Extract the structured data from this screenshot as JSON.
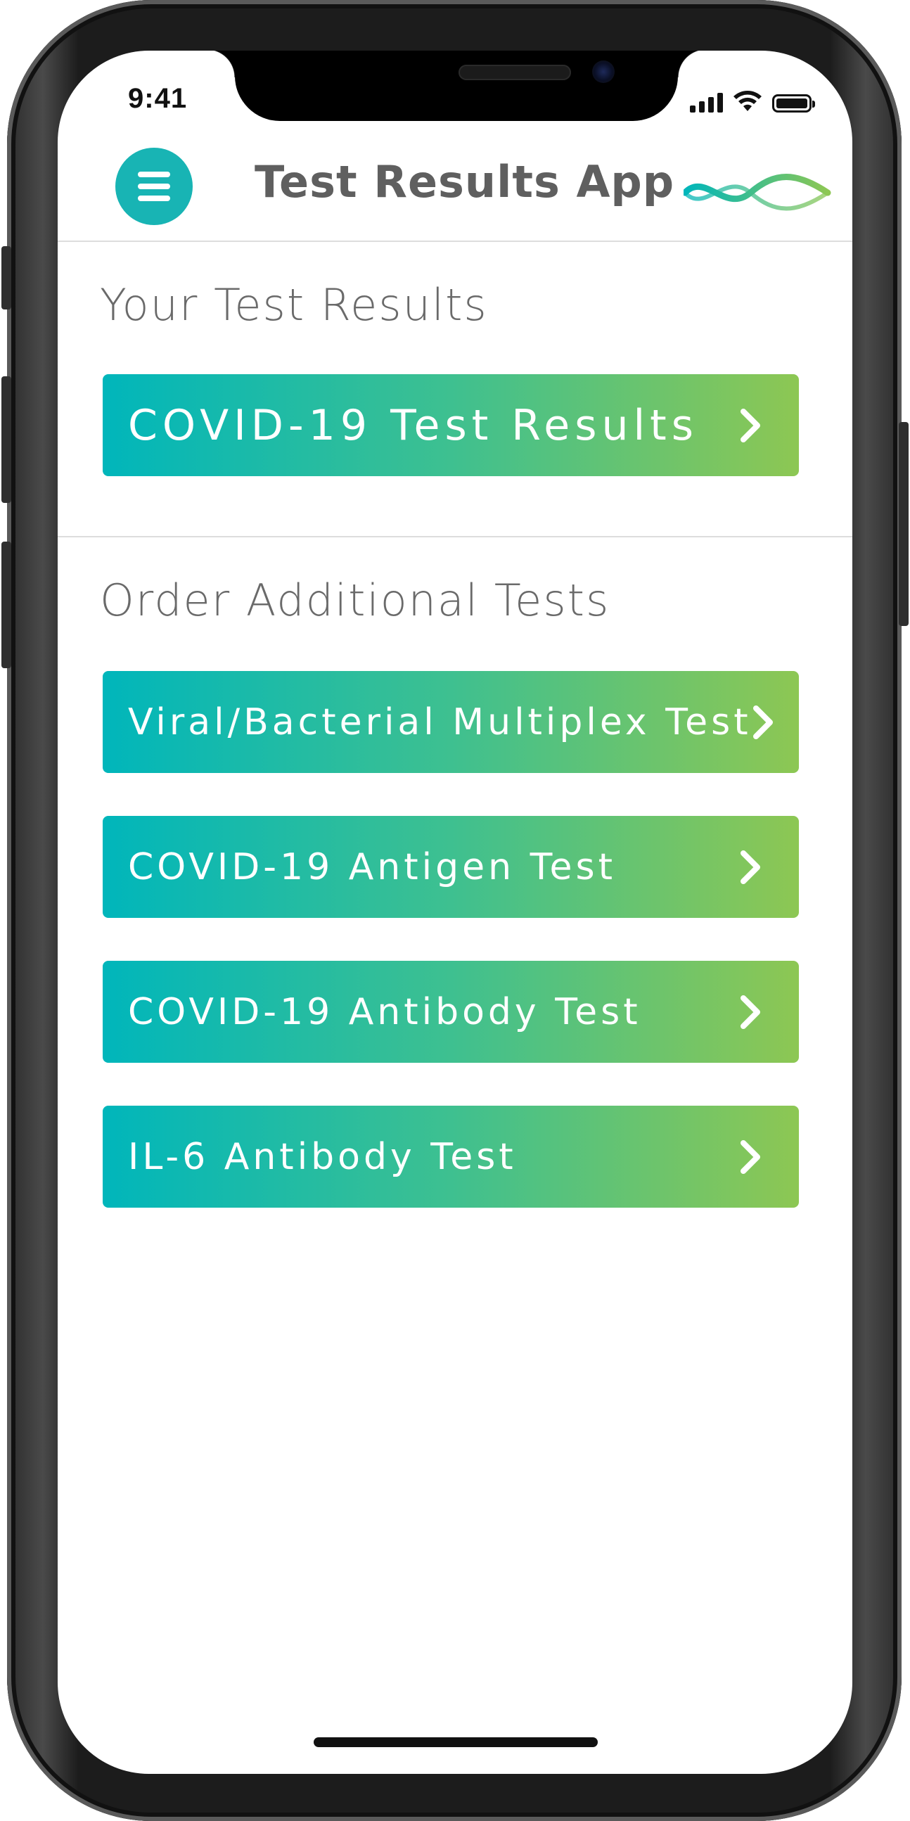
{
  "status_bar": {
    "time": "9:41"
  },
  "header": {
    "title": "Test Results App",
    "menu_icon": "hamburger-icon",
    "logo_icon": "dna-helix-logo"
  },
  "results_section": {
    "title": "Your Test Results",
    "buttons": [
      {
        "label": "COVID-19 Test Results",
        "icon": "chevron-right-icon"
      }
    ]
  },
  "order_section": {
    "title": "Order Additional Tests",
    "buttons": [
      {
        "label": "Viral/Bacterial Multiplex Test",
        "icon": "chevron-right-icon"
      },
      {
        "label": "COVID-19 Antigen Test",
        "icon": "chevron-right-icon"
      },
      {
        "label": "COVID-19 Antibody Test",
        "icon": "chevron-right-icon"
      },
      {
        "label": "IL-6 Antibody Test",
        "icon": "chevron-right-icon"
      }
    ]
  },
  "colors": {
    "accent": "#18b4b4",
    "gradient_start": "#00b6bb",
    "gradient_end": "#8dc753",
    "title_text": "#5f5f5f"
  }
}
